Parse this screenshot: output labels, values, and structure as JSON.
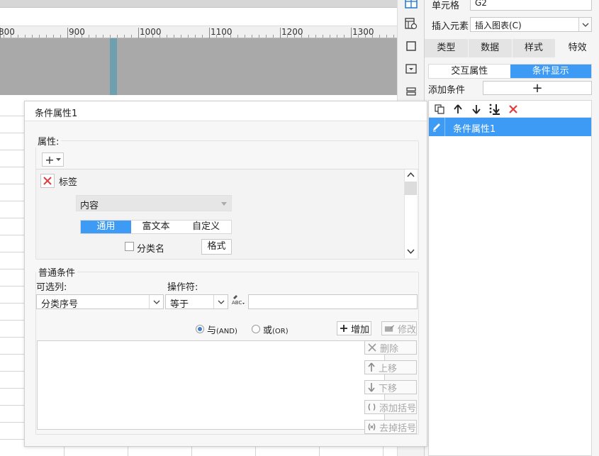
{
  "ruler": {
    "labels": [
      "800",
      "900",
      "1000",
      "1100",
      "1200",
      "1300"
    ]
  },
  "right_panel": {
    "cell_label": "单元格",
    "cell_value": "G2",
    "insert_label": "插入元素",
    "insert_value": "插入图表(C)",
    "tabs": [
      {
        "label": "类型",
        "active": false
      },
      {
        "label": "数据",
        "active": false
      },
      {
        "label": "样式",
        "active": false
      },
      {
        "label": "特效",
        "active": true
      }
    ],
    "subtabs": [
      {
        "label": "交互属性",
        "active": false
      },
      {
        "label": "条件显示",
        "active": true
      }
    ],
    "add_condition_label": "添加条件",
    "add_condition_button": "+",
    "list_items": [
      "条件属性1"
    ]
  },
  "dialog": {
    "title": "条件属性1",
    "attributes": {
      "legend": "属性:",
      "add_button": "+",
      "item_name": "标签",
      "content_select": "内容",
      "mode_tabs": [
        {
          "label": "通用",
          "active": true
        },
        {
          "label": "富文本",
          "active": false
        },
        {
          "label": "自定义",
          "active": false
        }
      ],
      "category_checkbox": "分类名",
      "category_checked": false,
      "format_button": "格式"
    },
    "condition": {
      "legend": "普通条件",
      "column_label": "可选列:",
      "column_value": "分类序号",
      "operator_label": "操作符:",
      "operator_value": "等于",
      "value": "",
      "and_label": "与",
      "and_code": "(AND)",
      "or_label": "或",
      "or_code": "(OR)",
      "logic_selected": "and",
      "add_button": "增加",
      "modify_button": "修改",
      "delete_button": "删除",
      "up_button": "上移",
      "down_button": "下移",
      "add_bracket_button": "添加括号",
      "remove_bracket_button": "去掉括号"
    }
  },
  "colors": {
    "accent": "#3d9bf6",
    "danger": "#e03c3c",
    "canvas_gray": "#a9a9a9",
    "canvas_marker": "#6d9fae"
  }
}
